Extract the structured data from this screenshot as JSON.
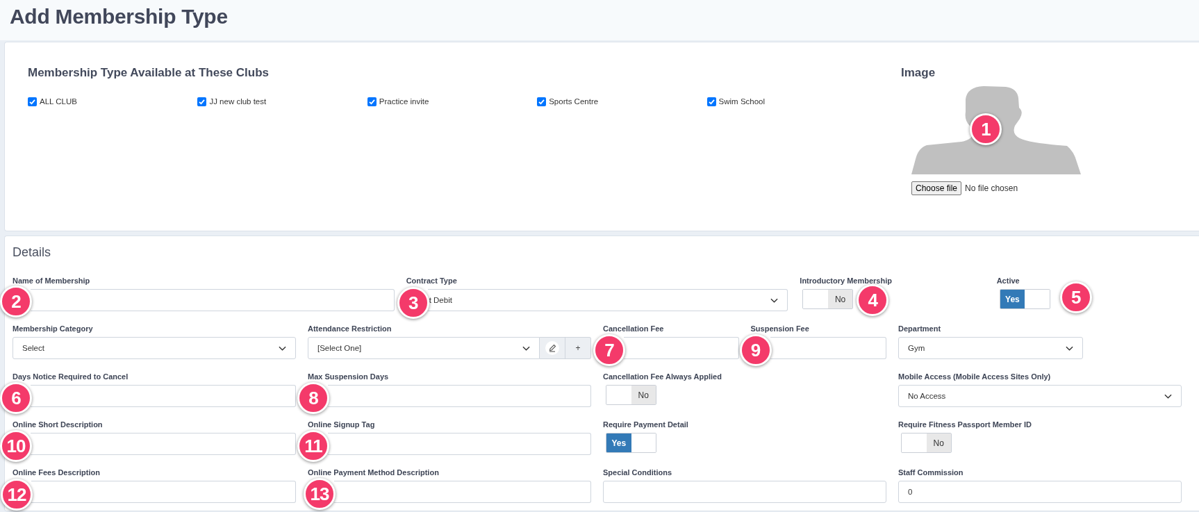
{
  "page": {
    "title": "Add Membership Type"
  },
  "clubs": {
    "heading": "Membership Type Available at These Clubs",
    "items": [
      {
        "label": "ALL CLUB",
        "checked": true
      },
      {
        "label": "JJ new club test",
        "checked": true
      },
      {
        "label": "Practice invite",
        "checked": true
      },
      {
        "label": "Sports Centre",
        "checked": true
      },
      {
        "label": "Swim School",
        "checked": true
      }
    ]
  },
  "image": {
    "heading": "Image",
    "marker": "1",
    "file_button": "Choose file",
    "file_status": "No file chosen"
  },
  "details": {
    "heading": "Details",
    "rows": [
      [
        {
          "label": "Name of Membership",
          "kind": "text",
          "marker": "2"
        },
        {
          "label": "Contract Type",
          "kind": "select",
          "value": "t Debit",
          "marker": "3"
        },
        {
          "label": "Introductory Membership",
          "kind": "toggle",
          "on": false,
          "state_text": "No",
          "marker": "4"
        },
        {
          "label": "Active",
          "kind": "toggle",
          "on": true,
          "state_text": "Yes",
          "marker": "5"
        }
      ],
      [
        {
          "label": "Membership Category",
          "kind": "select",
          "value": "Select"
        },
        {
          "label": "Attendance Restriction",
          "kind": "select_addon",
          "value": "[Select One]",
          "add_button": "+"
        },
        {
          "label": "Cancellation Fee",
          "kind": "text",
          "marker": "7"
        },
        {
          "label": "Suspension Fee",
          "kind": "text",
          "marker": "9"
        },
        {
          "label": "Department",
          "kind": "select",
          "value": "Gym"
        }
      ],
      [
        {
          "label": "Days Notice Required to Cancel",
          "kind": "text",
          "marker": "6"
        },
        {
          "label": "Max Suspension Days",
          "kind": "text",
          "marker": "8"
        },
        {
          "label": "Cancellation Fee Always Applied",
          "kind": "toggle",
          "on": false,
          "state_text": "No"
        },
        {
          "label": "Mobile Access (Mobile Access Sites Only)",
          "kind": "select",
          "value": "No Access"
        }
      ],
      [
        {
          "label": "Online Short Description",
          "kind": "text",
          "marker": "10"
        },
        {
          "label": "Online Signup Tag",
          "kind": "text",
          "marker": "11"
        },
        {
          "label": "Require Payment Detail",
          "kind": "toggle",
          "on": true,
          "state_text": "Yes"
        },
        {
          "label": "Require Fitness Passport Member ID",
          "kind": "toggle",
          "on": false,
          "state_text": "No"
        }
      ],
      [
        {
          "label": "Online Fees Description",
          "kind": "text",
          "marker": "12"
        },
        {
          "label": "Online Payment Method Description",
          "kind": "text",
          "marker": "13"
        },
        {
          "label": "Special Conditions",
          "kind": "text"
        },
        {
          "label": "Staff Commission",
          "kind": "text",
          "value": "0"
        }
      ]
    ]
  }
}
